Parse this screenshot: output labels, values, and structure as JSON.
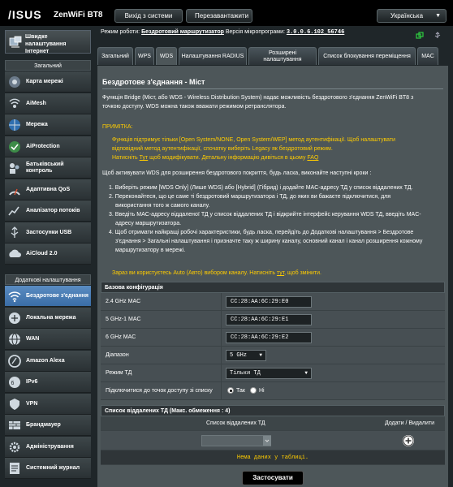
{
  "header": {
    "brand": "/ISUS",
    "model": "ZenWiFi BT8",
    "logout_label": "Вихід з системи",
    "reboot_label": "Перезавантажити",
    "language": "Українська"
  },
  "sidebar": {
    "wizard_label_1": "Швидке",
    "wizard_label_2": "налаштування",
    "wizard_label_3": "Інтернет",
    "general_header": "Загальний",
    "general_items": [
      {
        "label": "Карта мережі",
        "icon": "network-map-icon"
      },
      {
        "label": "AiMesh",
        "icon": "aimesh-icon"
      },
      {
        "label": "Мережа",
        "icon": "network-icon"
      },
      {
        "label": "AiProtection",
        "icon": "aiprotection-icon"
      },
      {
        "label": "Батьківський контроль",
        "icon": "parental-control-icon"
      },
      {
        "label": "Адаптивна QoS",
        "icon": "qos-icon"
      },
      {
        "label": "Аналізатор потоків",
        "icon": "traffic-analyzer-icon"
      },
      {
        "label": "Застосунки USB",
        "icon": "usb-icon"
      },
      {
        "label": "AiCloud 2.0",
        "icon": "aicloud-icon"
      }
    ],
    "advanced_header": "Додаткові налаштування",
    "advanced_items": [
      {
        "label": "Бездротове з'єднання",
        "icon": "wireless-icon"
      },
      {
        "label": "Локальна мережа",
        "icon": "lan-icon"
      },
      {
        "label": "WAN",
        "icon": "wan-icon"
      },
      {
        "label": "Amazon Alexa",
        "icon": "alexa-icon"
      },
      {
        "label": "IPv6",
        "icon": "ipv6-icon"
      },
      {
        "label": "VPN",
        "icon": "vpn-icon"
      },
      {
        "label": "Брандмауер",
        "icon": "firewall-icon"
      },
      {
        "label": "Адміністрування",
        "icon": "administration-icon"
      },
      {
        "label": "Системний журнал",
        "icon": "system-log-icon"
      }
    ]
  },
  "infobar": {
    "mode_label": "Режим роботи:",
    "mode_value": "Бездротовий маршрутизатор",
    "fw_label": "Версія мікропрограми:",
    "fw_value": "3.0.0.6.102_56746"
  },
  "tabs": [
    "Загальний",
    "WPS",
    "WDS",
    "Налаштування RADIUS",
    "Розширені налаштування",
    "Список блокування переміщення",
    "MAC"
  ],
  "main": {
    "title": "Бездротове з'єднання - Міст",
    "intro_1": "Функція Bridge (Міст, або WDS - Wireless Distribution System) надає можливість бездротового з'єднання ZenWiFi BT8 з",
    "intro_2": "точкою доступу. WDS можна також вважати режимом ретранслятора.",
    "note_title": "ПРИМІТКА:",
    "note_1": "Функція підтримує тільки [Open System/NONE, Open System/WEP] метод аутентифікації. Щоб налаштувати",
    "note_2": "відповідний метод аутентифікації, спочатку виберіть Legacy як бездротовий режим.",
    "note_3a": "Натисніть ",
    "note_3_link": "Тут",
    "note_3b": " щоб модифікувати. Детальну інформацію дивіться в цьому ",
    "note_3_faq": "FAQ",
    "steps_intro": "Щоб активувати WDS для розширення бездротового покриття, будь ласка, виконайте наступні кроки :",
    "step_1": "1. Виберіть режим [WDS Only] (Лише WDS) або [Hybrid] (Гібрид) і додайте MAC-адресу ТД у список віддалених ТД.",
    "step_2a": "2. Переконайтеся, що це саме ті бездротовий маршрутизатора і ТД, до яких ви бажаєте підключитися, для",
    "step_2b": "використання того ж самого каналу.",
    "step_3a": "3. Введіть MAC-адресу віддаленої ТД у список віддалених ТД і відкрийте інтерфейс керування WDS ТД, введіть MAC-",
    "step_3b": "адресу маршрутизатора.",
    "step_4a": "4. Щоб отримати найкращі робочі характеристики, будь ласка, перейдіть до Додаткові налаштування > Бездротове",
    "step_4b": "з'єднання > Загальні налаштування і призначте таку ж ширину каналу, основний канал і канал розширення кожному",
    "step_4c": "маршрутизатору в мережі.",
    "auto_a": "Зараз ви користуєтесь Auto (Авто) вибором каналу. Натисніть ",
    "auto_link": "тут",
    "auto_b": ", щоб змінити."
  },
  "basic_config": {
    "header": "Базова конфігурація",
    "mac_24_label": "2.4 GHz MAC",
    "mac_24_value": "CC:28:AA:6C:29:E0",
    "mac_5_label": "5 GHz-1 MAC",
    "mac_5_value": "CC:28:AA:6C:29:E1",
    "mac_6_label": "6 GHz MAC",
    "mac_6_value": "CC:28:AA:6C:29:E2",
    "band_label": "Діапазон",
    "band_value": "5 GHz",
    "ap_mode_label": "Режим ТД",
    "ap_mode_value": "Тільки ТД",
    "connect_label": "Підключитися до точок доступу зі списку",
    "yes_label": "Так",
    "no_label": "Ні"
  },
  "remote_list": {
    "header": "Список віддалених ТД (Макс. обмеження : 4)",
    "col_list": "Список віддалених ТД",
    "col_actions": "Додати / Видалити",
    "empty_text": "Нема даних у таблиці."
  },
  "apply_label": "Застосувати",
  "colors": {
    "accent": "#5a8cc2",
    "note_yellow": "#ffcc00",
    "empty_text": "#ffcc00",
    "panel": "#4d5659"
  }
}
